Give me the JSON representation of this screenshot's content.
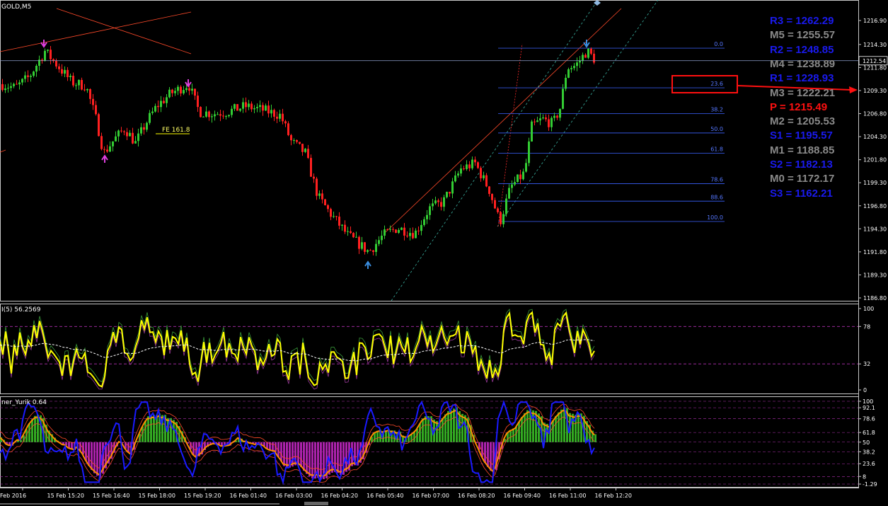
{
  "symbol_label": "GOLD,M5",
  "fe_label": "FE 161.8",
  "rsi_label": "I(5) 56.2569",
  "ind2_label": "ner_Yurik 0.64",
  "colors": {
    "background": "#000000",
    "bull": "#33cc33",
    "bear": "#ff2020",
    "fib": "#3355dd",
    "fib_text": "#5577ff",
    "rsi_line": "#ffff00",
    "level_line": "#b030b0",
    "grid_text": "#ffffff",
    "blue_line": "#1a1aff",
    "orange_line": "#ff8c00",
    "hist_pos": "#33aa22",
    "hist_neg": "#aa22aa",
    "pivot_blue": "#1a1aee",
    "pivot_gray": "#8a8a8a",
    "pivot_red": "#ff1010",
    "annot_red": "#ff1010"
  },
  "pivots": [
    {
      "name": "R3",
      "value": "R3 = 1262.29",
      "color": "blue"
    },
    {
      "name": "M5",
      "value": "M5 = 1255.57",
      "color": "gray"
    },
    {
      "name": "R2",
      "value": "R2 = 1248.85",
      "color": "blue"
    },
    {
      "name": "M4",
      "value": "M4 = 1238.89",
      "color": "gray"
    },
    {
      "name": "R1",
      "value": "R1 = 1228.93",
      "color": "blue"
    },
    {
      "name": "M3",
      "value": "M3 = 1222.21",
      "color": "gray"
    },
    {
      "name": "P",
      "value": "P  = 1215.49",
      "color": "red"
    },
    {
      "name": "M2",
      "value": "M2 = 1205.53",
      "color": "gray"
    },
    {
      "name": "S1",
      "value": "S1 = 1195.57",
      "color": "blue"
    },
    {
      "name": "M1",
      "value": "M1 = 1188.85",
      "color": "gray"
    },
    {
      "name": "S2",
      "value": "S2 = 1182.13",
      "color": "blue"
    },
    {
      "name": "M0",
      "value": "M0 = 1172.17",
      "color": "gray"
    },
    {
      "name": "S3",
      "value": "S3 = 1162.21",
      "color": "blue"
    }
  ],
  "chart_data": {
    "type": "candlestick",
    "price_axis": {
      "ticks": [
        "1216.90",
        "1214.30",
        "1211.80",
        "1209.30",
        "1206.80",
        "1204.30",
        "1201.80",
        "1199.30",
        "1196.80",
        "1194.30",
        "1191.80",
        "1189.30",
        "1186.80"
      ],
      "current_price": "1212.54",
      "range": [
        1185.5,
        1218.2
      ]
    },
    "time_axis": {
      "ticks": [
        "Feb 2016",
        "15 Feb 15:20",
        "15 Feb 16:40",
        "15 Feb 18:00",
        "15 Feb 19:20",
        "16 Feb 01:40",
        "16 Feb 03:00",
        "16 Feb 04:20",
        "16 Feb 05:40",
        "16 Feb 07:00",
        "16 Feb 08:20",
        "16 Feb 09:40",
        "16 Feb 11:00",
        "16 Feb 12:20"
      ]
    },
    "price_path": [
      [
        0,
        1210.0
      ],
      [
        20,
        1209.6
      ],
      [
        40,
        1210.8
      ],
      [
        62,
        1213.6
      ],
      [
        80,
        1212.0
      ],
      [
        100,
        1210.2
      ],
      [
        120,
        1209.8
      ],
      [
        135,
        1206.0
      ],
      [
        145,
        1202.5
      ],
      [
        160,
        1204.0
      ],
      [
        175,
        1205.2
      ],
      [
        190,
        1203.6
      ],
      [
        205,
        1205.8
      ],
      [
        220,
        1207.6
      ],
      [
        240,
        1209.0
      ],
      [
        265,
        1210.0
      ],
      [
        280,
        1207.0
      ],
      [
        300,
        1206.8
      ],
      [
        320,
        1207.0
      ],
      [
        345,
        1207.6
      ],
      [
        370,
        1207.2
      ],
      [
        395,
        1206.6
      ],
      [
        410,
        1203.8
      ],
      [
        430,
        1202.5
      ],
      [
        448,
        1197.8
      ],
      [
        465,
        1196.0
      ],
      [
        490,
        1193.6
      ],
      [
        520,
        1191.8
      ],
      [
        540,
        1193.6
      ],
      [
        560,
        1194.4
      ],
      [
        585,
        1193.8
      ],
      [
        605,
        1196.5
      ],
      [
        625,
        1197.2
      ],
      [
        650,
        1200.8
      ],
      [
        670,
        1201.4
      ],
      [
        690,
        1198.5
      ],
      [
        705,
        1195.0
      ],
      [
        720,
        1198.8
      ],
      [
        740,
        1200.4
      ],
      [
        750,
        1205.4
      ],
      [
        765,
        1206.2
      ],
      [
        780,
        1205.7
      ],
      [
        790,
        1207.4
      ],
      [
        800,
        1211.8
      ],
      [
        812,
        1212.0
      ],
      [
        828,
        1213.6
      ],
      [
        840,
        1212.6
      ]
    ],
    "fibonacci": {
      "levels": [
        "0.0",
        "23.6",
        "38.2",
        "50.0",
        "61.8",
        "78.6",
        "88.6",
        "100.0"
      ],
      "prices": [
        1213.9,
        1209.6,
        1206.8,
        1204.7,
        1202.5,
        1199.2,
        1197.3,
        1195.1
      ]
    },
    "rsi": {
      "label": "I(5) 56.2569",
      "levels": [
        "100",
        "78",
        "32",
        "0"
      ],
      "current": 56.2569
    },
    "oscillator": {
      "label": "ner_Yurik 0.64",
      "levels": [
        "100",
        "92.1",
        "78.6",
        "61.8",
        "50",
        "38.2",
        "23.6",
        "8",
        "-1.29"
      ]
    }
  }
}
